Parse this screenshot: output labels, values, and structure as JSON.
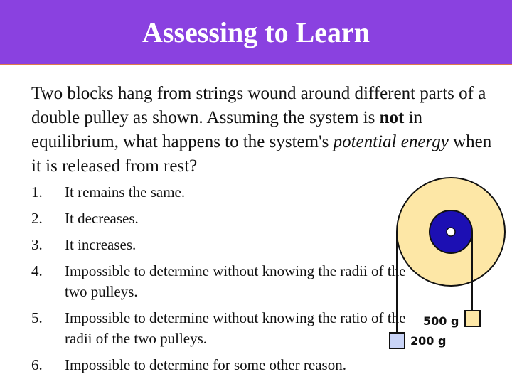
{
  "title": "Assessing to Learn",
  "question": {
    "part1": "Two blocks hang from strings wound around different parts of a double pulley as shown. Assuming the system is ",
    "bold": "not",
    "part2": " in equilibrium, what happens to the system's ",
    "italic": "potential energy",
    "part3": " when it is released from rest?"
  },
  "options": [
    {
      "num": "1.",
      "text": "It remains the same."
    },
    {
      "num": "2.",
      "text": "It decreases."
    },
    {
      "num": "3.",
      "text": "It increases."
    },
    {
      "num": "4.",
      "text": "Impossible to determine without knowing the radii of the two pulleys."
    },
    {
      "num": "5.",
      "text": "Impossible to determine without knowing the ratio of the radii of the two pulleys."
    },
    {
      "num": "6.",
      "text": "Impossible to determine for some other reason."
    }
  ],
  "figure": {
    "label_heavy": "500 g",
    "label_light": "200 g"
  },
  "colors": {
    "header": "#8a41e0",
    "outer_pulley": "#fde7a6",
    "inner_pulley": "#1c0fb3",
    "light_block": "#c9d4f7",
    "heavy_block": "#fde7a6"
  }
}
